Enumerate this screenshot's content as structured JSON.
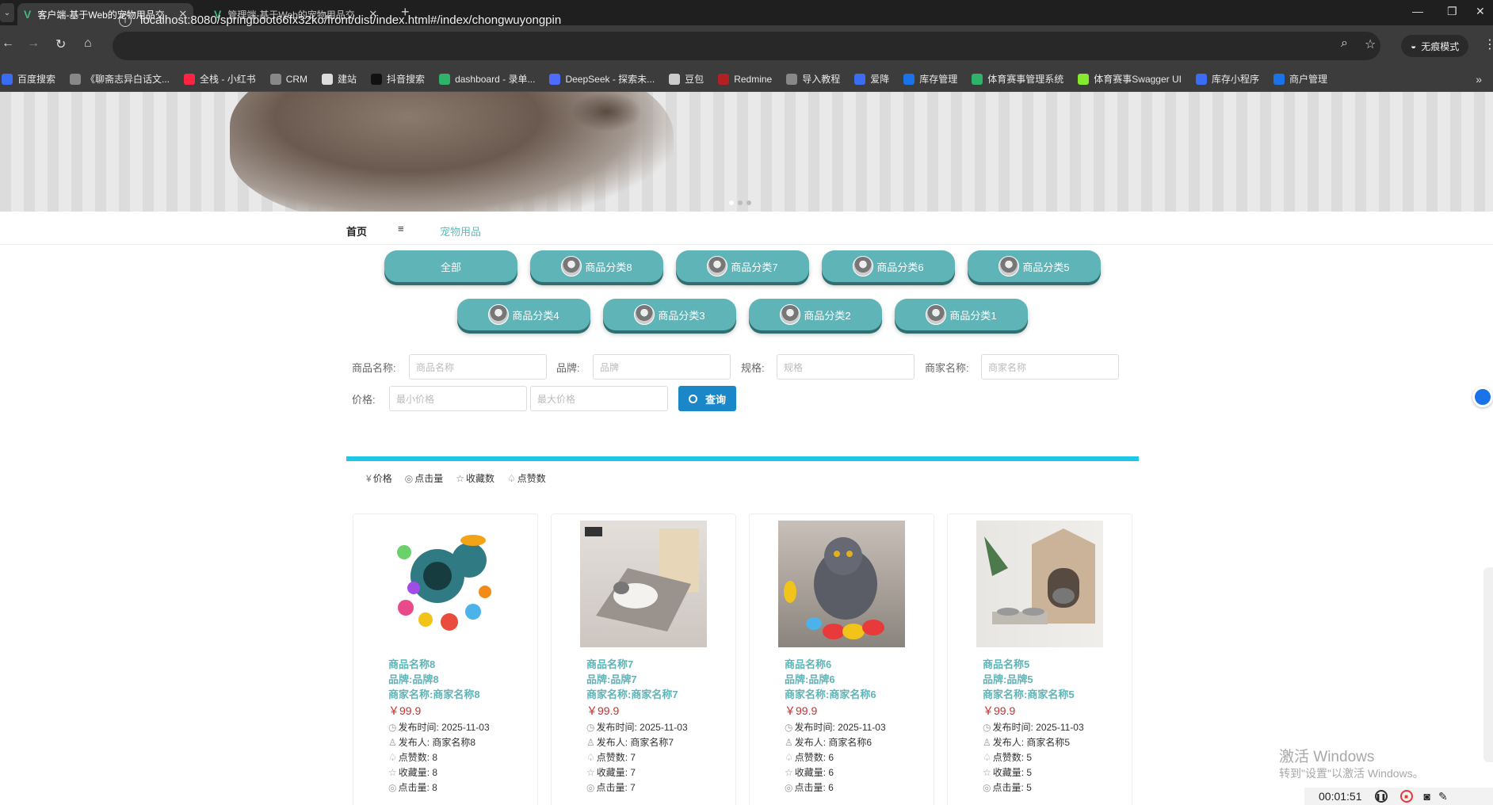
{
  "browser": {
    "tabs": [
      {
        "title": "客户端-基于Web的宠物用品交",
        "active": true
      },
      {
        "title": "管理端-基于Web的宠物用品交",
        "active": false
      }
    ],
    "url": "localhost:8080/springboot66fx32ko/front/dist/index.html#/index/chongwuyongpin",
    "incognito_label": "无痕模式",
    "bookmarks": [
      {
        "label": "百度搜索",
        "color": "#3a6cf4"
      },
      {
        "label": "《聊斋志异白话文...",
        "color": "#888888"
      },
      {
        "label": "全栈 - 小红书",
        "color": "#ff2442"
      },
      {
        "label": "CRM",
        "color": "#888888"
      },
      {
        "label": "建站",
        "color": "#dddddd"
      },
      {
        "label": "抖音搜索",
        "color": "#111111"
      },
      {
        "label": "dashboard - 录单...",
        "color": "#2fb36a"
      },
      {
        "label": "DeepSeek - 探索未...",
        "color": "#4d6bfe"
      },
      {
        "label": "豆包",
        "color": "#cccccc"
      },
      {
        "label": "Redmine",
        "color": "#b32024"
      },
      {
        "label": "导入教程",
        "color": "#888888"
      },
      {
        "label": "爱降",
        "color": "#3a6cf4"
      },
      {
        "label": "库存管理",
        "color": "#1a73e8"
      },
      {
        "label": "体育赛事管理系统",
        "color": "#2fb36a"
      },
      {
        "label": "体育赛事Swagger UI",
        "color": "#85ea2d"
      },
      {
        "label": "库存小程序",
        "color": "#3a6cf4"
      },
      {
        "label": "商户管理",
        "color": "#1a73e8"
      }
    ]
  },
  "breadcrumb": {
    "home": "首页",
    "separator": "≡",
    "current": "宠物用品"
  },
  "categories": {
    "all": "全部",
    "items": [
      "商品分类8",
      "商品分类7",
      "商品分类6",
      "商品分类5",
      "商品分类4",
      "商品分类3",
      "商品分类2",
      "商品分类1"
    ]
  },
  "search": {
    "name_label": "商品名称:",
    "name_placeholder": "商品名称",
    "brand_label": "品牌:",
    "brand_placeholder": "品牌",
    "spec_label": "规格:",
    "spec_placeholder": "规格",
    "shop_label": "商家名称:",
    "shop_placeholder": "商家名称",
    "price_label": "价格:",
    "min_price_placeholder": "最小价格",
    "max_price_placeholder": "最大价格",
    "button_label": "查询"
  },
  "sort": [
    {
      "icon": "¥",
      "label": "价格"
    },
    {
      "icon": "◎",
      "label": "点击量"
    },
    {
      "icon": "☆",
      "label": "收藏数"
    },
    {
      "icon": "♤",
      "label": "点赞数"
    }
  ],
  "products": [
    {
      "name": "商品名称8",
      "brand": "品牌:品牌8",
      "shop": "商家名称:商家名称8",
      "price": "￥99.9",
      "time": "发布时间: 2025-11-03",
      "publisher": "发布人: 商家名称8",
      "likes": "点赞数: 8",
      "favorites": "收藏量: 8",
      "clicks": "点击量: 8"
    },
    {
      "name": "商品名称7",
      "brand": "品牌:品牌7",
      "shop": "商家名称:商家名称7",
      "price": "￥99.9",
      "time": "发布时间: 2025-11-03",
      "publisher": "发布人: 商家名称7",
      "likes": "点赞数: 7",
      "favorites": "收藏量: 7",
      "clicks": "点击量: 7"
    },
    {
      "name": "商品名称6",
      "brand": "品牌:品牌6",
      "shop": "商家名称:商家名称6",
      "price": "￥99.9",
      "time": "发布时间: 2025-11-03",
      "publisher": "发布人: 商家名称6",
      "likes": "点赞数: 6",
      "favorites": "收藏量: 6",
      "clicks": "点击量: 6"
    },
    {
      "name": "商品名称5",
      "brand": "品牌:品牌5",
      "shop": "商家名称:商家名称5",
      "price": "￥99.9",
      "time": "发布时间: 2025-11-03",
      "publisher": "发布人: 商家名称5",
      "likes": "点赞数: 5",
      "favorites": "收藏量: 5",
      "clicks": "点击量: 5"
    }
  ],
  "overlay": {
    "activate_title": "激活 Windows",
    "activate_sub": "转到\"设置\"以激活 Windows。",
    "recorder_time": "00:01:51"
  },
  "colors": {
    "accent": "#5fb4b7",
    "button": "#1a87c9",
    "divider": "#1fc7e6",
    "price": "#d52a2a"
  }
}
